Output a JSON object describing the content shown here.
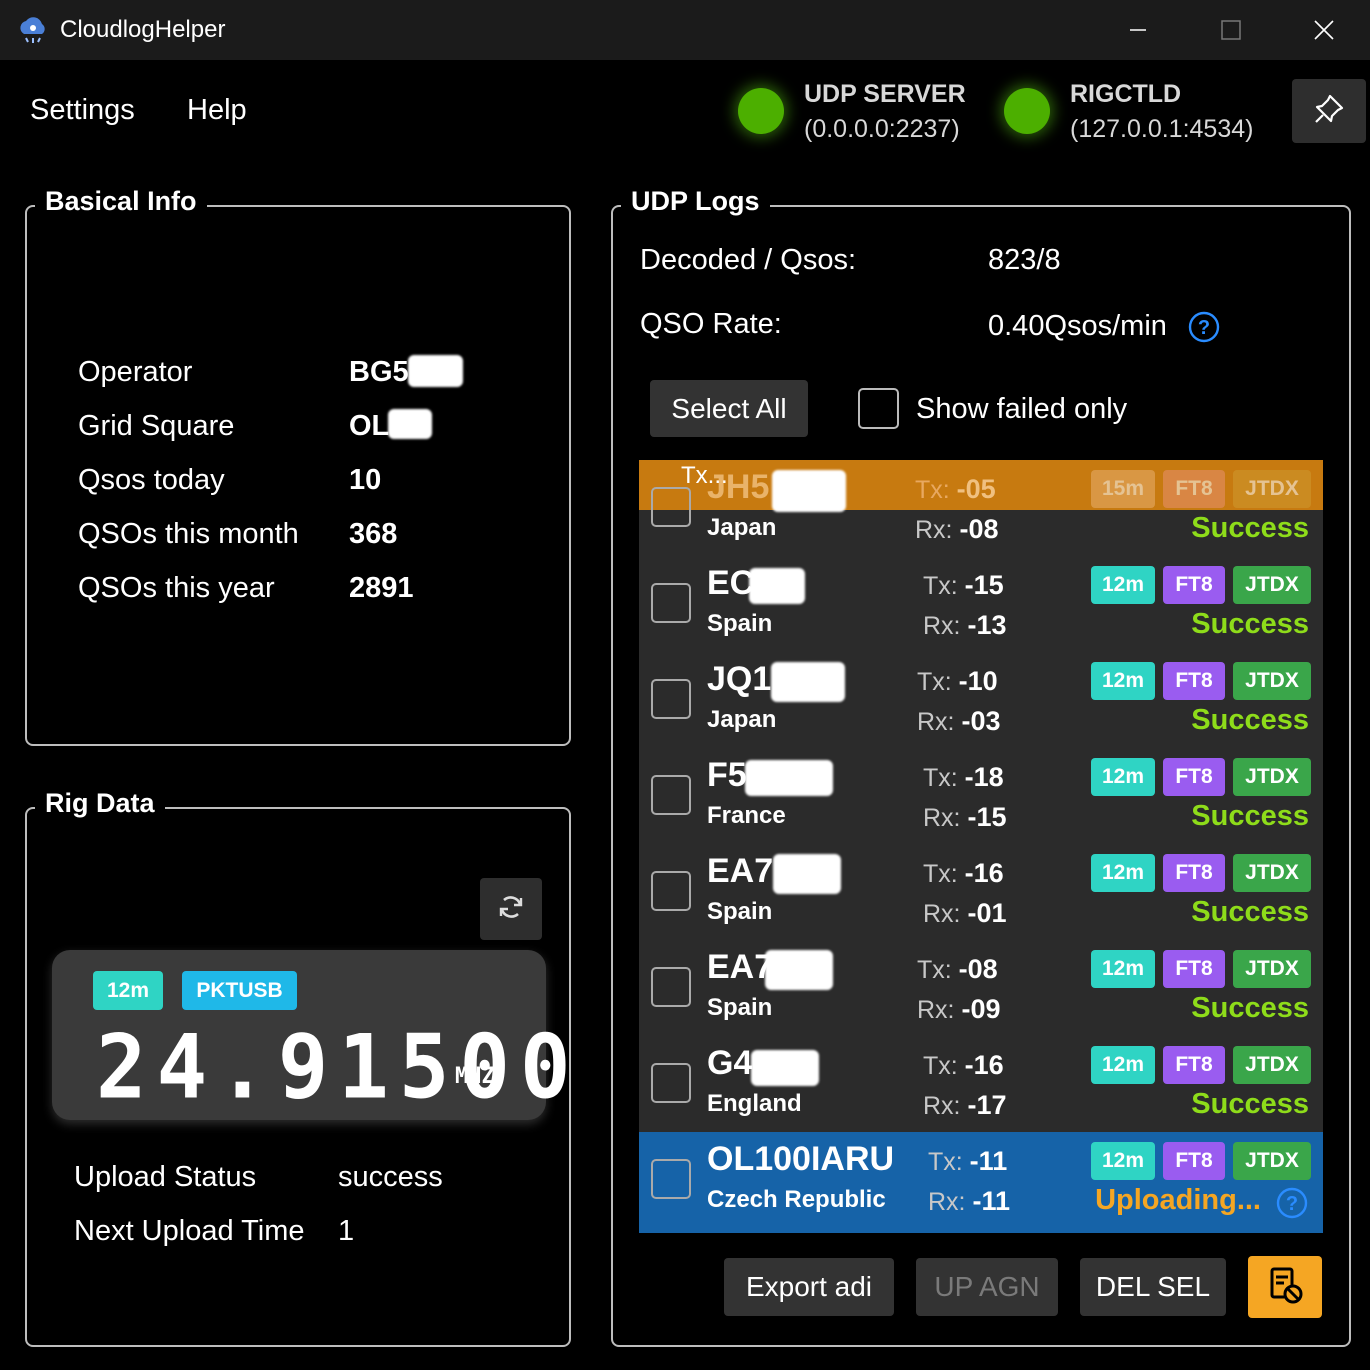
{
  "window": {
    "title": "CloudlogHelper"
  },
  "menu": {
    "settings": "Settings",
    "help": "Help"
  },
  "status": {
    "udp": {
      "name": "UDP SERVER",
      "addr": "(0.0.0.0:2237)",
      "color": "#4caf00"
    },
    "rig": {
      "name": "RIGCTLD",
      "addr": "(127.0.0.1:4534)",
      "color": "#4caf00"
    }
  },
  "basic_info": {
    "title": "Basical Info",
    "rows": [
      {
        "label": "Operator",
        "value": "BG5"
      },
      {
        "label": "Grid Square",
        "value": "OL"
      },
      {
        "label": "Qsos today",
        "value": "10"
      },
      {
        "label": "QSOs this month",
        "value": "368"
      },
      {
        "label": "QSOs this year",
        "value": "2891"
      }
    ]
  },
  "rig_data": {
    "title": "Rig Data",
    "band": "12m",
    "mode": "PKTUSB",
    "frequency": "24.91500",
    "unit": "MHZ",
    "upload_status_label": "Upload Status",
    "upload_status_value": "success",
    "next_upload_label": "Next Upload Time",
    "next_upload_value": "1"
  },
  "udp_logs": {
    "title": "UDP Logs",
    "decoded_label": "Decoded / Qsos:",
    "decoded_value": "823/8",
    "rate_label": "QSO Rate:",
    "rate_value": "0.40Qsos/min",
    "select_all": "Select All",
    "show_failed": "Show failed only",
    "tooltip_fragment": "Tx...",
    "rows": [
      {
        "call": "JH5",
        "country": "Japan",
        "tx_label": "Tx:",
        "tx": "-05",
        "rx_label": "Rx:",
        "rx": "-08",
        "band": "15m",
        "mode": "FT8",
        "app": "JTDX",
        "status": "Success"
      },
      {
        "call": "EC",
        "country": "Spain",
        "tx_label": "Tx:",
        "tx": "-15",
        "rx_label": "Rx:",
        "rx": "-13",
        "band": "12m",
        "mode": "FT8",
        "app": "JTDX",
        "status": "Success"
      },
      {
        "call": "JQ1",
        "country": "Japan",
        "tx_label": "Tx:",
        "tx": "-10",
        "rx_label": "Rx:",
        "rx": "-03",
        "band": "12m",
        "mode": "FT8",
        "app": "JTDX",
        "status": "Success"
      },
      {
        "call": "F5",
        "country": "France",
        "tx_label": "Tx:",
        "tx": "-18",
        "rx_label": "Rx:",
        "rx": "-15",
        "band": "12m",
        "mode": "FT8",
        "app": "JTDX",
        "status": "Success"
      },
      {
        "call": "EA7",
        "country": "Spain",
        "tx_label": "Tx:",
        "tx": "-16",
        "rx_label": "Rx:",
        "rx": "-01",
        "band": "12m",
        "mode": "FT8",
        "app": "JTDX",
        "status": "Success"
      },
      {
        "call": "EA7",
        "country": "Spain",
        "tx_label": "Tx:",
        "tx": "-08",
        "rx_label": "Rx:",
        "rx": "-09",
        "band": "12m",
        "mode": "FT8",
        "app": "JTDX",
        "status": "Success"
      },
      {
        "call": "G4",
        "country": "England",
        "tx_label": "Tx:",
        "tx": "-16",
        "rx_label": "Rx:",
        "rx": "-17",
        "band": "12m",
        "mode": "FT8",
        "app": "JTDX",
        "status": "Success"
      },
      {
        "call": "OL100IARU",
        "country": "Czech Republic",
        "tx_label": "Tx:",
        "tx": "-11",
        "rx_label": "Rx:",
        "rx": "-11",
        "band": "12m",
        "mode": "FT8",
        "app": "JTDX",
        "status": "Uploading..."
      }
    ],
    "buttons": {
      "export": "Export adi",
      "upload_again": "UP AGN",
      "delete_selected": "DEL SEL"
    }
  },
  "colors": {
    "accent_orange": "#f5a623",
    "highlight_row": "#c77a10",
    "selected_row": "#1663a8",
    "success_green": "#8edc1a",
    "band_tag": "#2fd4c4",
    "mode_tag": "#9a5cf0",
    "app_tag": "#3aa64a",
    "pktusb_tag": "#1fb8e8"
  }
}
